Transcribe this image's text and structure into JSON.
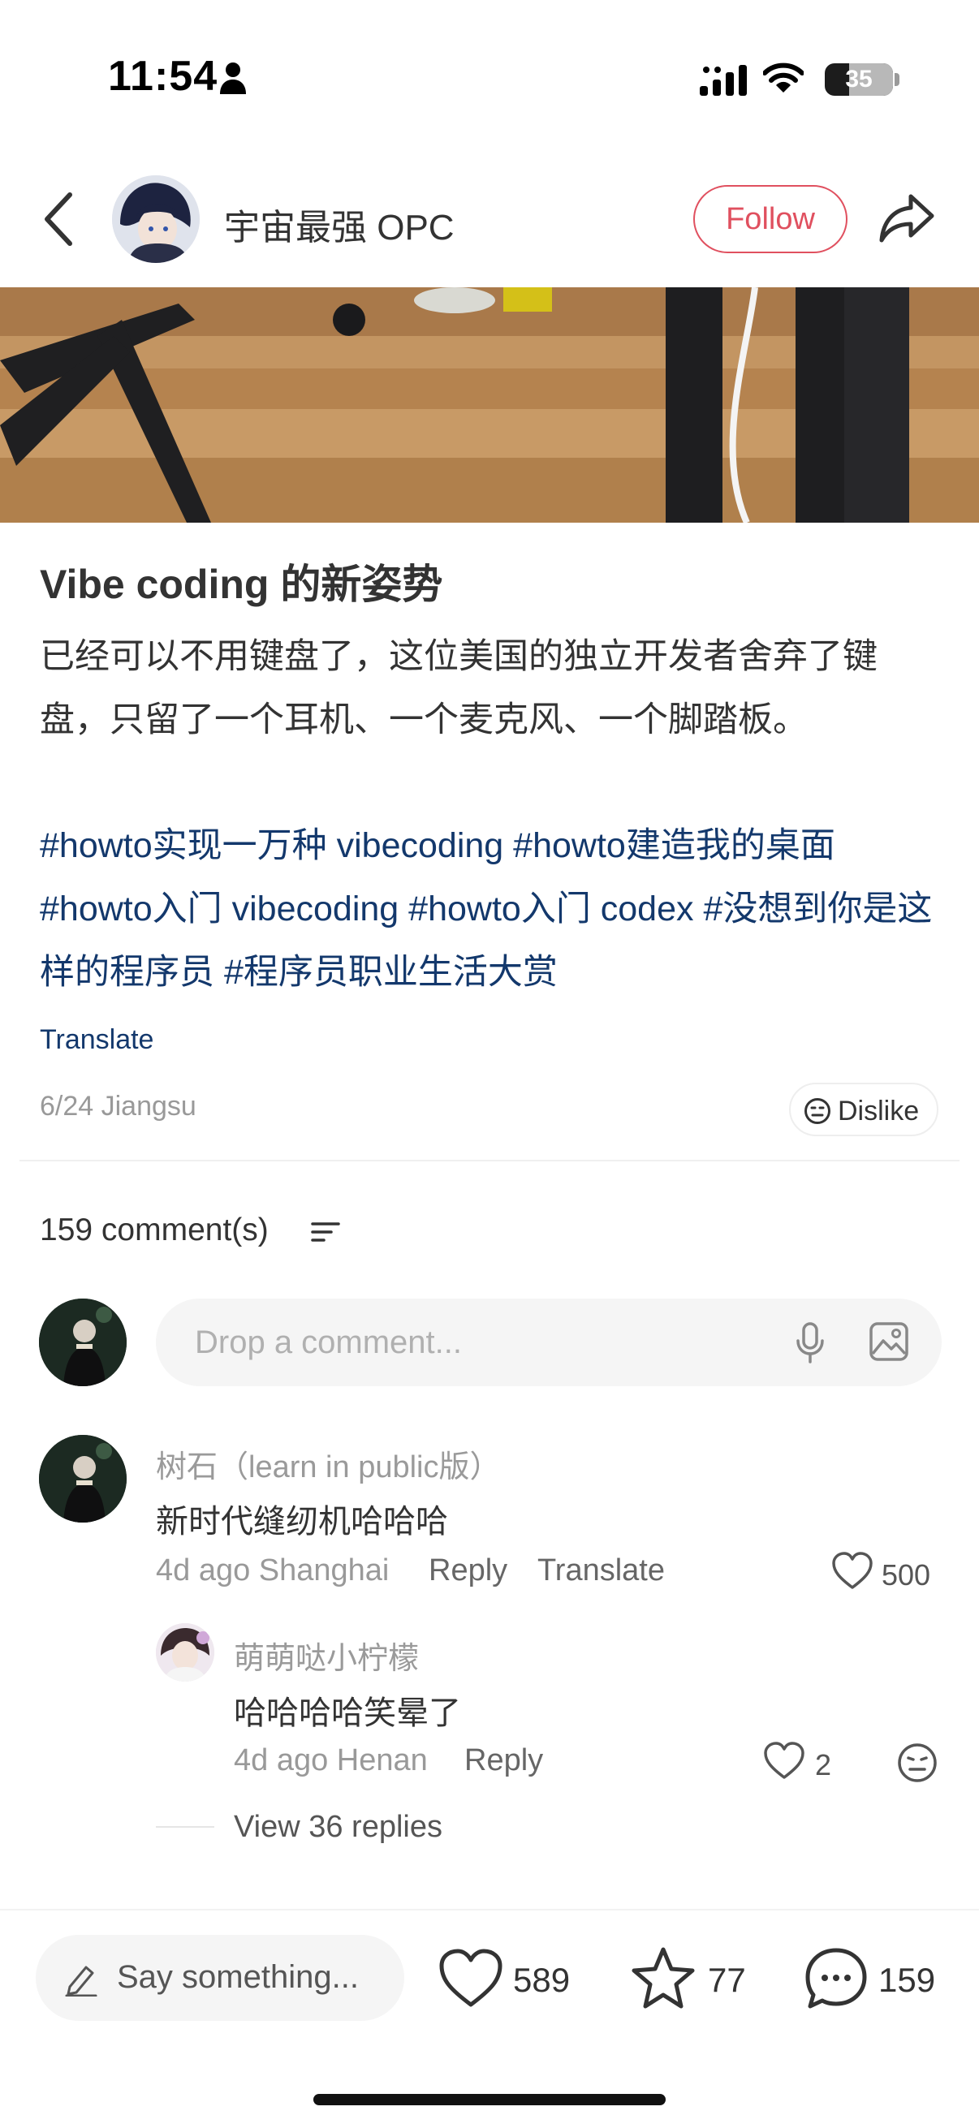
{
  "status_bar": {
    "time": "11:54",
    "battery_level": "35",
    "icons": [
      "person-icon",
      "signal-icon",
      "wifi-icon",
      "battery-icon"
    ]
  },
  "header": {
    "author_name": "宇宙最强 OPC",
    "follow_label": "Follow",
    "icons": [
      "back-icon",
      "share-icon"
    ]
  },
  "post": {
    "title": "Vibe coding 的新姿势",
    "body": "已经可以不用键盘了，这位美国的独立开发者舍弃了键盘，只留了一个耳机、一个麦克风、一个脚踏板。",
    "tags": [
      "#howto实现一万种 vibecoding",
      "#howto建造我的桌面",
      "#howto入门 vibecoding",
      "#howto入门 codex",
      "#没想到你是这样的程序员",
      "#程序员职业生活大赏"
    ],
    "translate_label": "Translate",
    "meta": "6/24 Jiangsu",
    "dislike_label": "Dislike"
  },
  "comments": {
    "count_label": "159 comment(s)",
    "input_placeholder": "Drop a comment...",
    "items": [
      {
        "user": "树石（learn in public版）",
        "text": "新时代缝纫机哈哈哈",
        "meta": "4d ago Shanghai",
        "reply_label": "Reply",
        "translate_label": "Translate",
        "likes": "500"
      },
      {
        "user": "萌萌哒小柠檬",
        "text": "哈哈哈哈笑晕了",
        "meta": "4d ago Henan",
        "reply_label": "Reply",
        "likes": "2"
      }
    ],
    "view_replies_label": "View 36 replies"
  },
  "bottom_bar": {
    "say_placeholder": "Say something...",
    "likes": "589",
    "collects": "77",
    "comments": "159"
  },
  "colors": {
    "accent": "#e0505f",
    "tag_link": "#13386c",
    "muted_text": "#999999"
  }
}
